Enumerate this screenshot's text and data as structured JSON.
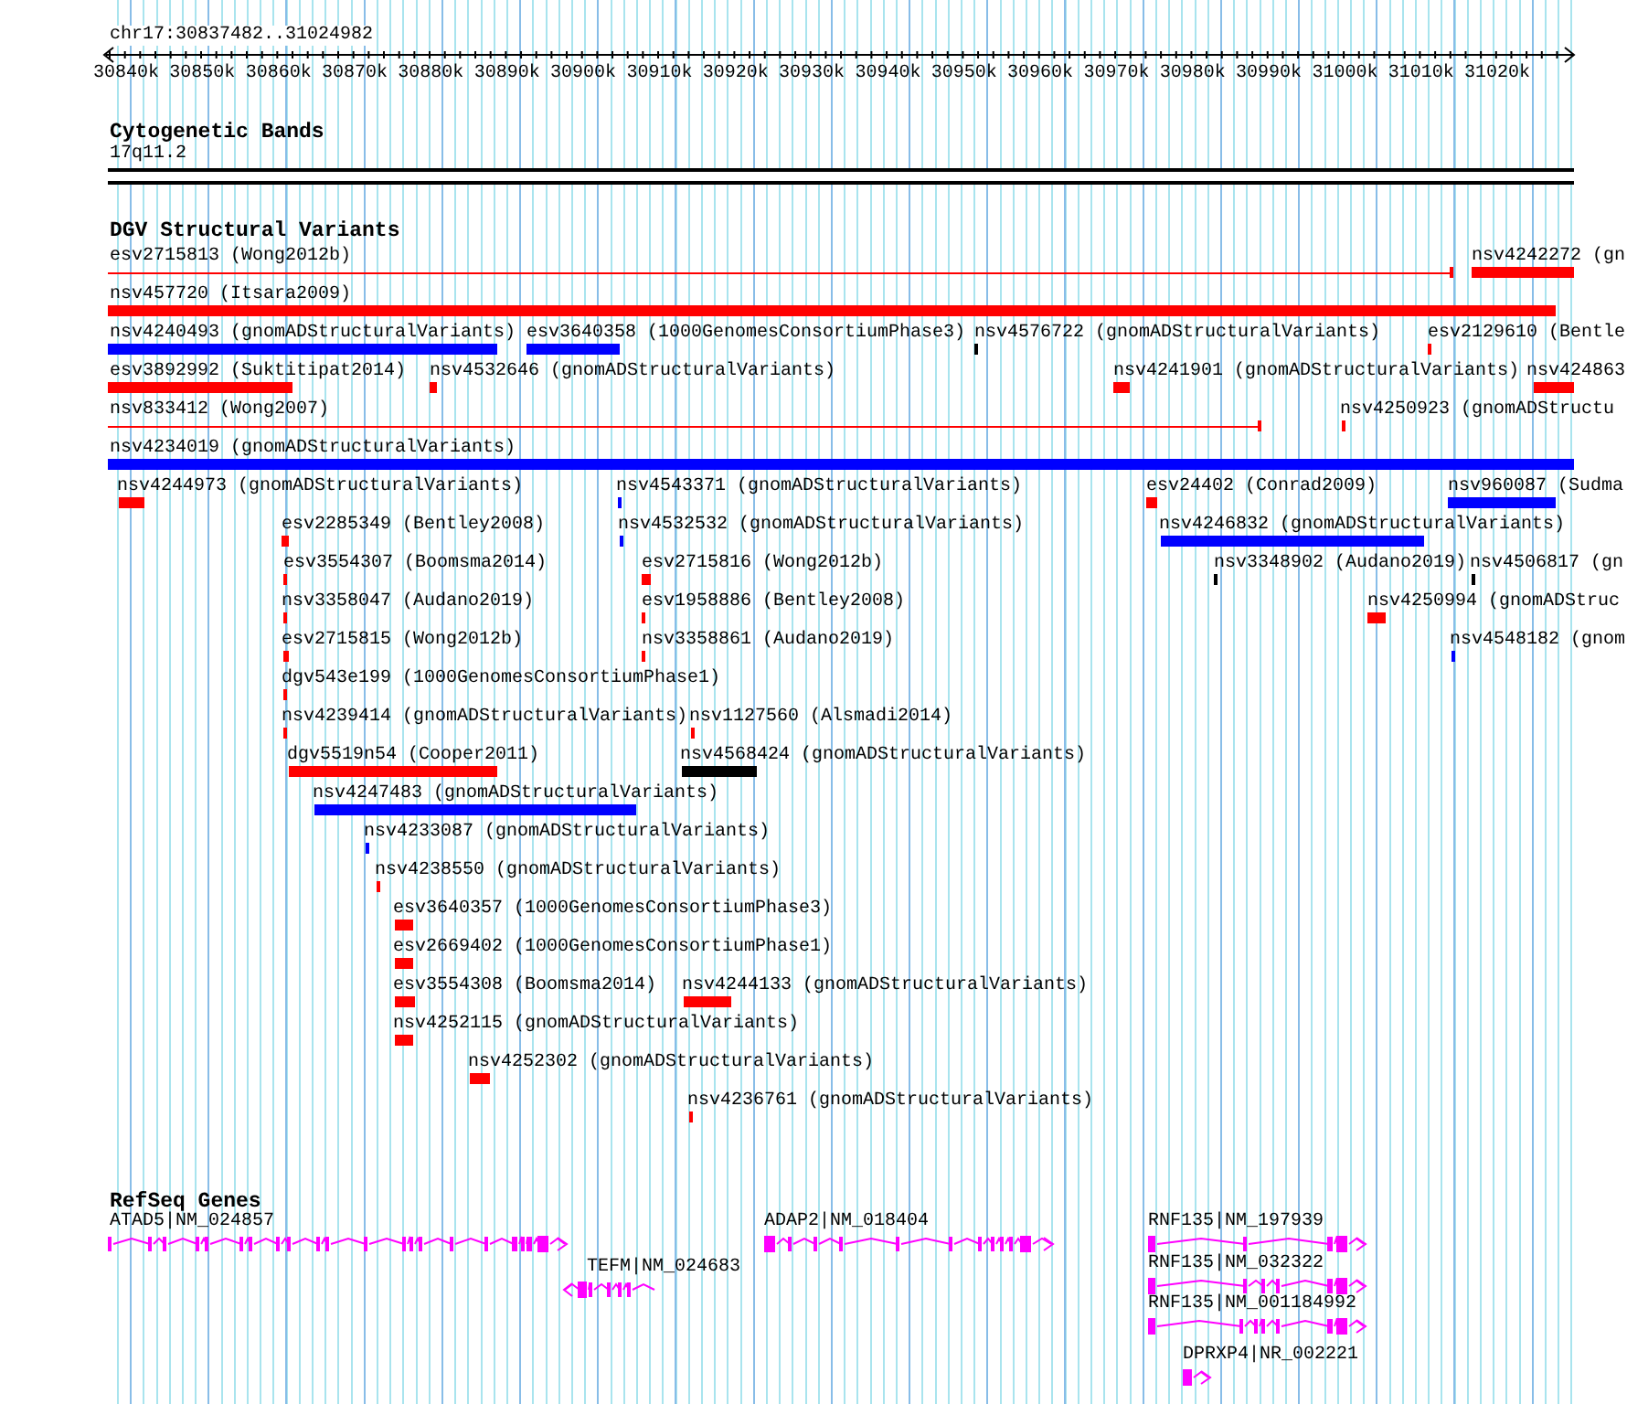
{
  "ruler": {
    "location": "chr17:30837482..31024982",
    "ticks": [
      "30840k",
      "30850k",
      "30860k",
      "30870k",
      "30880k",
      "30890k",
      "30900k",
      "30910k",
      "30920k",
      "30930k",
      "30940k",
      "30950k",
      "30960k",
      "30970k",
      "30980k",
      "30990k",
      "31000k",
      "31010k",
      "31020k"
    ]
  },
  "tracks": [
    {
      "kind": "bands",
      "title": "Cytogenetic Bands",
      "bands": [
        {
          "label": "17q11.2"
        }
      ]
    },
    {
      "kind": "variants",
      "title": "DGV Structural Variants",
      "features": [
        {
          "label": "esv2715813 (Wong2012b)",
          "kind": "line",
          "color": "#ff0000"
        },
        {
          "label": "nsv4242272 (gn",
          "kind": "bar",
          "color": "#ff0000"
        },
        {
          "label": "nsv457720 (Itsara2009)",
          "kind": "bar",
          "color": "#ff0000"
        },
        {
          "label": "nsv4240493 (gnomADStructuralVariants)",
          "kind": "bar",
          "color": "#0000ff"
        },
        {
          "label": "esv3640358 (1000GenomesConsortiumPhase3)",
          "kind": "bar",
          "color": "#0000ff"
        },
        {
          "label": "nsv4576722 (gnomADStructuralVariants)",
          "kind": "bar",
          "color": "#000000"
        },
        {
          "label": "esv2129610 (Bentle",
          "kind": "bar",
          "color": "#ff0000"
        },
        {
          "label": "esv3892992 (Suktitipat2014)",
          "kind": "bar",
          "color": "#ff0000"
        },
        {
          "label": "nsv4532646 (gnomADStructuralVariants)",
          "kind": "bar",
          "color": "#ff0000"
        },
        {
          "label": "nsv4241901 (gnomADStructuralVariants)",
          "kind": "bar",
          "color": "#ff0000"
        },
        {
          "label": "nsv424863",
          "kind": "bar",
          "color": "#ff0000"
        },
        {
          "label": "nsv833412 (Wong2007)",
          "kind": "line",
          "color": "#ff0000"
        },
        {
          "label": "nsv4250923 (gnomADStructu",
          "kind": "bar",
          "color": "#ff0000"
        },
        {
          "label": "nsv4234019 (gnomADStructuralVariants)",
          "kind": "bar",
          "color": "#0000ff"
        },
        {
          "label": "nsv4244973 (gnomADStructuralVariants)",
          "kind": "bar",
          "color": "#ff0000"
        },
        {
          "label": "nsv4543371 (gnomADStructuralVariants)",
          "kind": "bar",
          "color": "#0000ff"
        },
        {
          "label": "esv24402 (Conrad2009)",
          "kind": "bar",
          "color": "#ff0000"
        },
        {
          "label": "nsv960087 (Sudma",
          "kind": "bar",
          "color": "#0000ff"
        },
        {
          "label": "esv2285349 (Bentley2008)",
          "kind": "bar",
          "color": "#ff0000"
        },
        {
          "label": "nsv4532532 (gnomADStructuralVariants)",
          "kind": "bar",
          "color": "#0000ff"
        },
        {
          "label": "nsv4246832 (gnomADStructuralVariants)",
          "kind": "bar",
          "color": "#0000ff"
        },
        {
          "label": "esv3554307 (Boomsma2014)",
          "kind": "bar",
          "color": "#ff0000"
        },
        {
          "label": "esv2715816 (Wong2012b)",
          "kind": "bar",
          "color": "#ff0000"
        },
        {
          "label": "nsv3348902 (Audano2019)",
          "kind": "bar",
          "color": "#000000"
        },
        {
          "label": "nsv4506817 (gn",
          "kind": "bar",
          "color": "#000000"
        },
        {
          "label": "nsv3358047 (Audano2019)",
          "kind": "bar",
          "color": "#ff0000"
        },
        {
          "label": "esv1958886 (Bentley2008)",
          "kind": "bar",
          "color": "#ff0000"
        },
        {
          "label": "nsv4250994 (gnomADStruc",
          "kind": "bar",
          "color": "#ff0000"
        },
        {
          "label": "esv2715815 (Wong2012b)",
          "kind": "bar",
          "color": "#ff0000"
        },
        {
          "label": "nsv3358861 (Audano2019)",
          "kind": "bar",
          "color": "#ff0000"
        },
        {
          "label": "nsv4548182 (gnom",
          "kind": "bar",
          "color": "#0000ff"
        },
        {
          "label": "dgv543e199 (1000GenomesConsortiumPhase1)",
          "kind": "bar",
          "color": "#ff0000"
        },
        {
          "label": "nsv4239414 (gnomADStructuralVariants)",
          "kind": "bar",
          "color": "#ff0000"
        },
        {
          "label": "nsv1127560 (Alsmadi2014)",
          "kind": "bar",
          "color": "#ff0000"
        },
        {
          "label": "dgv5519n54 (Cooper2011)",
          "kind": "bar",
          "color": "#ff0000"
        },
        {
          "label": "nsv4568424 (gnomADStructuralVariants)",
          "kind": "bar",
          "color": "#000000"
        },
        {
          "label": "nsv4247483 (gnomADStructuralVariants)",
          "kind": "bar",
          "color": "#0000ff"
        },
        {
          "label": "nsv4233087 (gnomADStructuralVariants)",
          "kind": "bar",
          "color": "#0000ff"
        },
        {
          "label": "nsv4238550 (gnomADStructuralVariants)",
          "kind": "bar",
          "color": "#ff0000"
        },
        {
          "label": "esv3640357 (1000GenomesConsortiumPhase3)",
          "kind": "bar",
          "color": "#ff0000"
        },
        {
          "label": "esv2669402 (1000GenomesConsortiumPhase1)",
          "kind": "bar",
          "color": "#ff0000"
        },
        {
          "label": "esv3554308 (Boomsma2014)",
          "kind": "bar",
          "color": "#ff0000"
        },
        {
          "label": "nsv4244133 (gnomADStructuralVariants)",
          "kind": "bar",
          "color": "#ff0000"
        },
        {
          "label": "nsv4252115 (gnomADStructuralVariants)",
          "kind": "bar",
          "color": "#ff0000"
        },
        {
          "label": "nsv4252302 (gnomADStructuralVariants)",
          "kind": "bar",
          "color": "#ff0000"
        },
        {
          "label": "nsv4236761 (gnomADStructuralVariants)",
          "kind": "bar",
          "color": "#ff0000"
        }
      ]
    },
    {
      "kind": "genes",
      "title": "RefSeq Genes",
      "features": [
        {
          "label": "ATAD5|NM_024857",
          "reverse": false
        },
        {
          "label": "ADAP2|NM_018404",
          "reverse": false
        },
        {
          "label": "RNF135|NM_197939",
          "reverse": false
        },
        {
          "label": "TEFM|NM_024683",
          "reverse": true
        },
        {
          "label": "RNF135|NM_032322",
          "reverse": false
        },
        {
          "label": "RNF135|NM_001184992",
          "reverse": false
        },
        {
          "label": "DPRXP4|NR_002221",
          "reverse": false
        }
      ]
    }
  ]
}
